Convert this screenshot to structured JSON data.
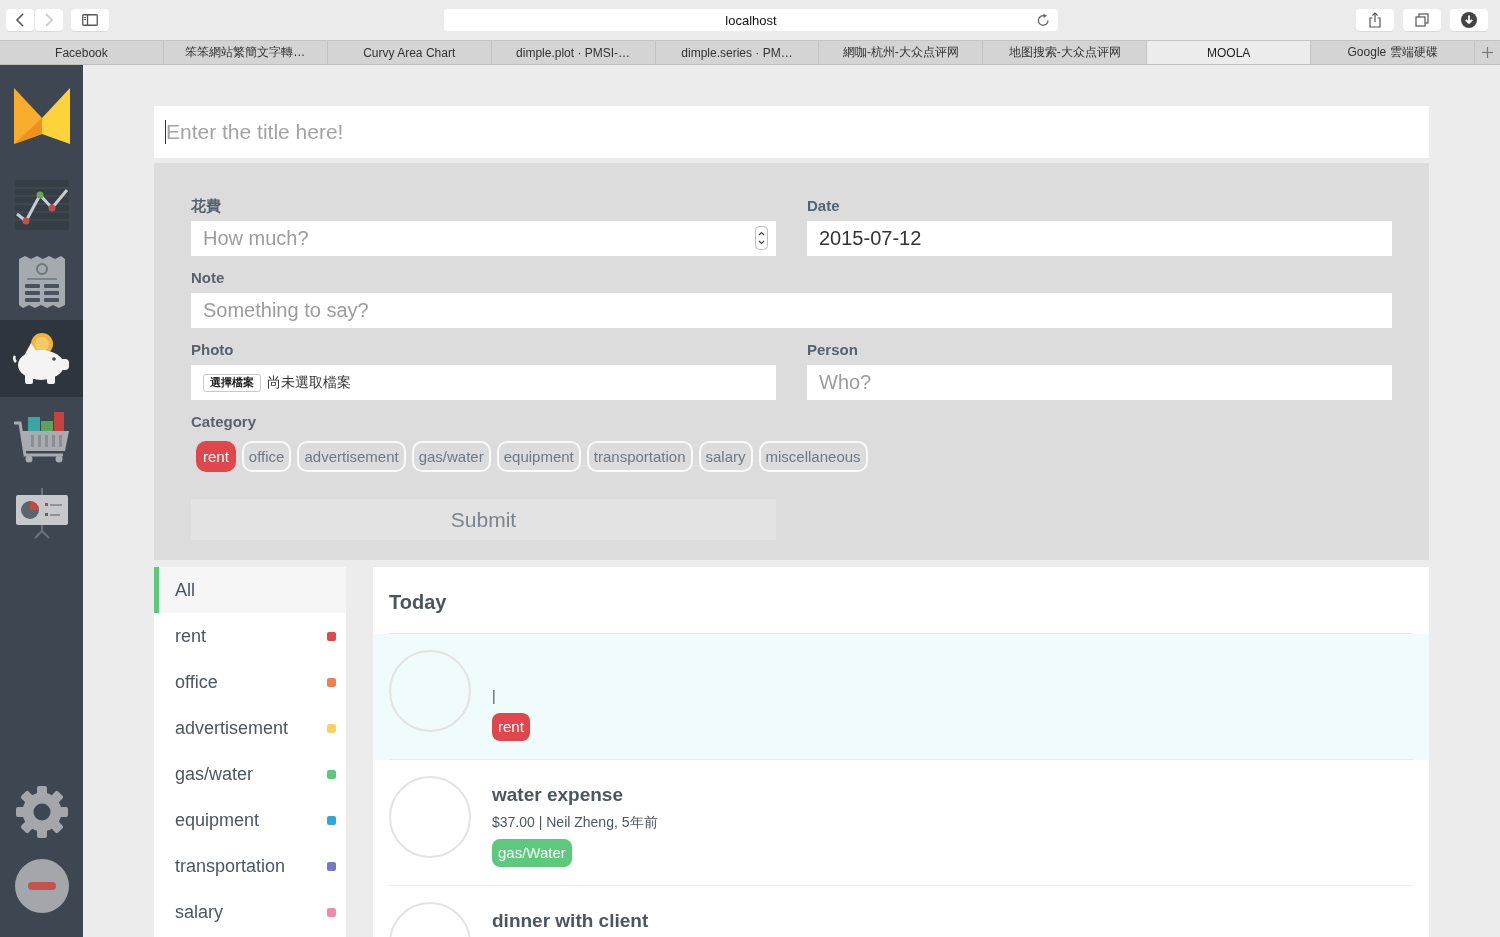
{
  "browser": {
    "nav_buttons": [
      {
        "kind": "back",
        "disabled": false
      },
      {
        "kind": "forward",
        "disabled": true
      }
    ],
    "address": "localhost",
    "tabs": [
      {
        "label": "Facebook",
        "selected": false
      },
      {
        "label": "笨笨網站繁簡文字轉…",
        "selected": false
      },
      {
        "label": "Curvy Area Chart",
        "selected": false
      },
      {
        "label": "dimple.plot · PMSI-…",
        "selected": false
      },
      {
        "label": "dimple.series · PM…",
        "selected": false
      },
      {
        "label": "網咖-杭州-大众点评网",
        "selected": false
      },
      {
        "label": "地图搜索-大众点评网",
        "selected": false
      },
      {
        "label": "MOOLA",
        "selected": true
      },
      {
        "label": "Google 雲端硬碟",
        "selected": false
      }
    ]
  },
  "app_sidebar": {
    "items": [
      {
        "kind": "chart",
        "selected": false
      },
      {
        "kind": "receipt",
        "selected": false
      },
      {
        "kind": "piggy_bank",
        "selected": true
      },
      {
        "kind": "cart",
        "selected": false
      },
      {
        "kind": "presentation",
        "selected": false
      }
    ],
    "actions": [
      {
        "kind": "settings"
      },
      {
        "kind": "remove"
      }
    ]
  },
  "title_field": {
    "placeholder": "Enter the title here!",
    "focused": true
  },
  "form": {
    "amount": {
      "label": "花費",
      "placeholder": "How much?"
    },
    "date": {
      "label": "Date",
      "value": "2015-07-12"
    },
    "note": {
      "label": "Note",
      "placeholder": "Something to say?"
    },
    "photo": {
      "label": "Photo",
      "button": "選擇檔案",
      "status": "尚未選取檔案"
    },
    "person": {
      "label": "Person",
      "placeholder": "Who?"
    },
    "category": {
      "label": "Category",
      "options": [
        {
          "label": "rent",
          "selected": true
        },
        {
          "label": "office",
          "selected": false
        },
        {
          "label": "advertisement",
          "selected": false
        },
        {
          "label": "gas/water",
          "selected": false
        },
        {
          "label": "equipment",
          "selected": false
        },
        {
          "label": "transportation",
          "selected": false
        },
        {
          "label": "salary",
          "selected": false
        },
        {
          "label": "miscellaneous",
          "selected": false
        }
      ]
    },
    "submit": {
      "label": "Submit",
      "disabled": true
    }
  },
  "filter_list": {
    "items": [
      {
        "label": "All",
        "selected": true
      },
      {
        "label": "rent",
        "selected": false,
        "color": "#e0474c"
      },
      {
        "label": "office",
        "selected": false,
        "color": "#f08050"
      },
      {
        "label": "advertisement",
        "selected": false,
        "color": "#fbd262"
      },
      {
        "label": "gas/water",
        "selected": false,
        "color": "#5cc97a"
      },
      {
        "label": "equipment",
        "selected": false,
        "color": "#2fa8d5"
      },
      {
        "label": "transportation",
        "selected": false,
        "color": "#7579c0"
      },
      {
        "label": "salary",
        "selected": false,
        "color": "#ef8aae"
      }
    ]
  },
  "feed": {
    "heading": "Today",
    "entries": [
      {
        "details": "|",
        "tag": {
          "label": "rent",
          "color": "#e0474c"
        },
        "selected": true
      },
      {
        "title": "water expense",
        "details": "$37.00 | Neil Zheng, 5年前",
        "tag": {
          "label": "gas/Water",
          "color": "#5dc97c"
        },
        "selected": false
      },
      {
        "title": "dinner with client",
        "selected": false
      }
    ]
  }
}
